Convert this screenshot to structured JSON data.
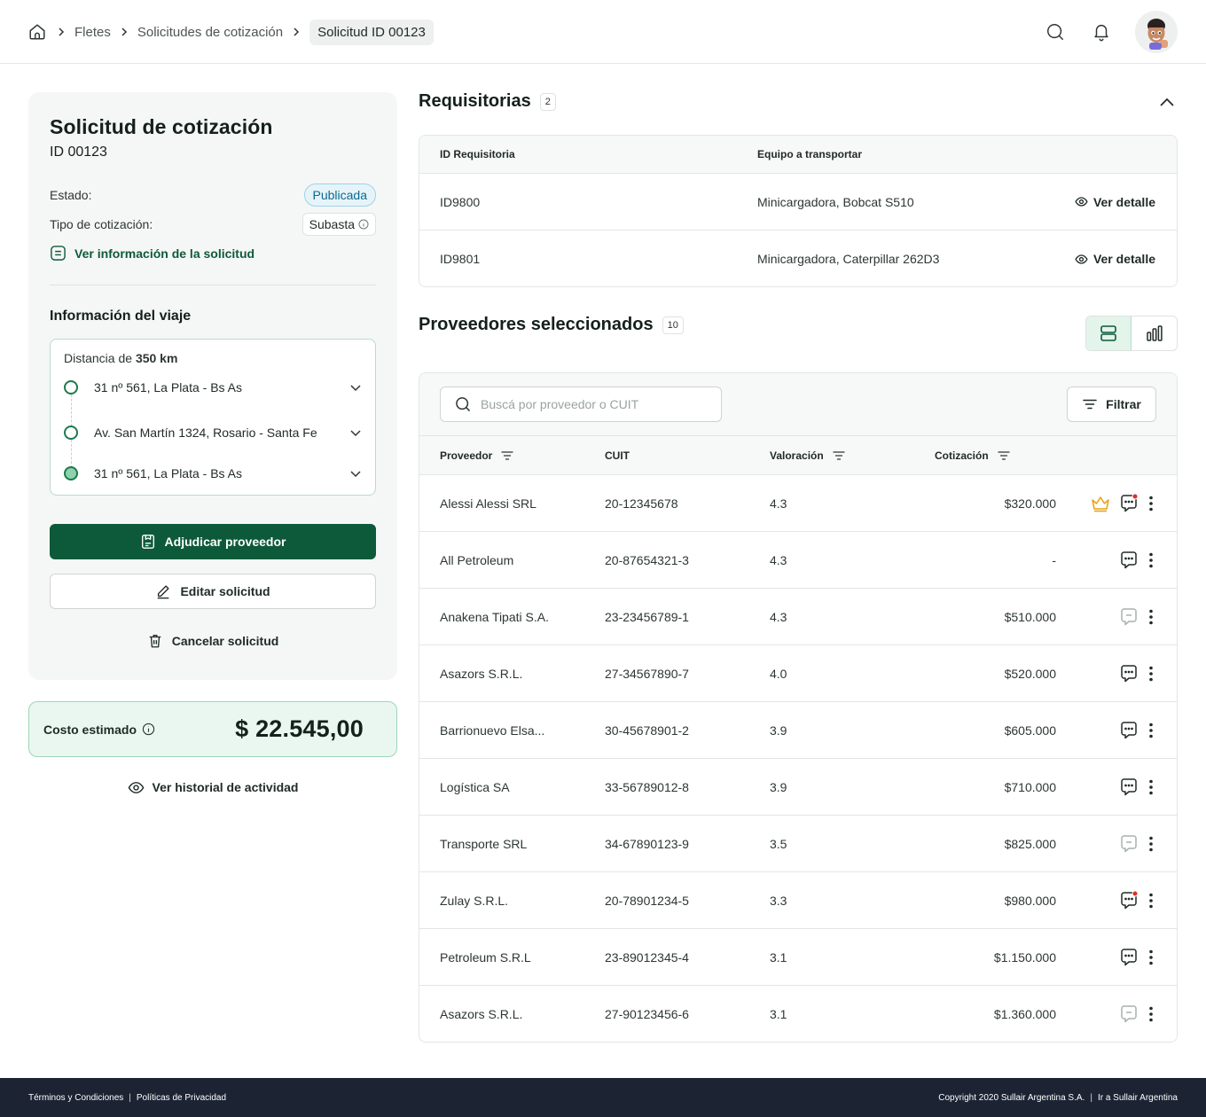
{
  "breadcrumb": {
    "items": [
      "Fletes",
      "Solicitudes de cotización"
    ],
    "current": "Solicitud ID 00123"
  },
  "request": {
    "title": "Solicitud de cotización",
    "id": "ID 00123",
    "status_label": "Estado:",
    "status_value": "Publicada",
    "type_label": "Tipo de cotización:",
    "type_value": "Subasta",
    "info_link": "Ver información de la solicitud"
  },
  "trip": {
    "title": "Información del viaje",
    "distance_prefix": "Distancia de",
    "distance_value": "350 km",
    "stops": [
      "31 nº 561,  La Plata - Bs As",
      "Av. San Martín 1324, Rosario - Santa Fe",
      "31 nº 561,  La Plata - Bs As"
    ]
  },
  "actions": {
    "award": "Adjudicar proveedor",
    "edit": "Editar solicitud",
    "cancel": "Cancelar solicitud"
  },
  "cost": {
    "label": "Costo estimado",
    "value": "$ 22.545,00"
  },
  "history_link": "Ver historial de actividad",
  "requisitions": {
    "title": "Requisitorias",
    "count": "2",
    "columns": [
      "ID Requisitoria",
      "Equipo a transportar"
    ],
    "detail_label": "Ver detalle",
    "rows": [
      {
        "id": "ID9800",
        "equipment": "Minicargadora, Bobcat S510"
      },
      {
        "id": "ID9801",
        "equipment": "Minicargadora, Caterpillar 262D3"
      }
    ]
  },
  "providers": {
    "title": "Proveedores seleccionados",
    "count": "10",
    "search_placeholder": "Buscá por proveedor o CUIT",
    "filter_label": "Filtrar",
    "columns": [
      "Proveedor",
      "CUIT",
      "Valoración",
      "Cotización"
    ],
    "rows": [
      {
        "name": "Alessi Alessi SRL",
        "cuit": "20-12345678",
        "rating": "4.3",
        "quote": "$320.000",
        "winner": true,
        "chat": "unread"
      },
      {
        "name": "All Petroleum",
        "cuit": "20-87654321-3",
        "rating": "4.3",
        "quote": "-",
        "winner": false,
        "chat": "active"
      },
      {
        "name": "Anakena Tipati S.A.",
        "cuit": "23-23456789-1",
        "rating": "4.3",
        "quote": "$510.000",
        "winner": false,
        "chat": "disabled"
      },
      {
        "name": "Asazors S.R.L.",
        "cuit": "27-34567890-7",
        "rating": "4.0",
        "quote": "$520.000",
        "winner": false,
        "chat": "active"
      },
      {
        "name": "Barrionuevo Elsa...",
        "cuit": "30-45678901-2",
        "rating": "3.9",
        "quote": "$605.000",
        "winner": false,
        "chat": "active"
      },
      {
        "name": "Logística SA",
        "cuit": "33-56789012-8",
        "rating": "3.9",
        "quote": "$710.000",
        "winner": false,
        "chat": "active"
      },
      {
        "name": "Transporte SRL",
        "cuit": "34-67890123-9",
        "rating": "3.5",
        "quote": "$825.000",
        "winner": false,
        "chat": "disabled"
      },
      {
        "name": "Zulay S.R.L.",
        "cuit": "20-78901234-5",
        "rating": "3.3",
        "quote": "$980.000",
        "winner": false,
        "chat": "unread"
      },
      {
        "name": "Petroleum S.R.L",
        "cuit": "23-89012345-4",
        "rating": "3.1",
        "quote": "$1.150.000",
        "winner": false,
        "chat": "active"
      },
      {
        "name": "Asazors S.R.L.",
        "cuit": "27-90123456-6",
        "rating": "3.1",
        "quote": "$1.360.000",
        "winner": false,
        "chat": "disabled"
      }
    ]
  },
  "footer": {
    "terms": "Términos y Condiciones",
    "privacy": "Políticas de Privacidad",
    "copyright": "Copyright 2020 Sullair Argentina S.A.",
    "external": "Ir a Sullair Argentina"
  },
  "colors": {
    "primary": "#0d5a3a",
    "footer_bg": "#1c2434",
    "crown": "#e8a317",
    "notification": "#d93025"
  }
}
